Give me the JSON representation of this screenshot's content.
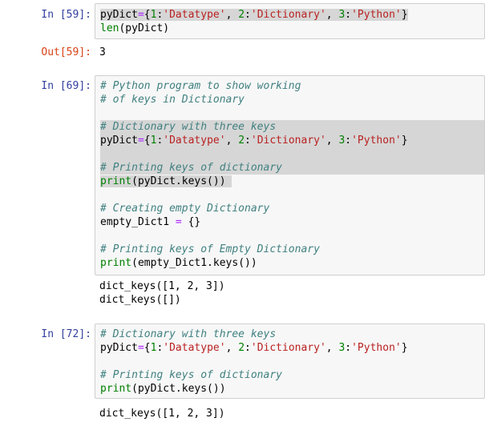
{
  "cells": [
    {
      "in_prompt": "In [59]:",
      "lines": [
        [
          "pyDict",
          "=",
          "{",
          "1",
          ":",
          "'Datatype'",
          ", ",
          "2",
          ":",
          "'Dictionary'",
          ", ",
          "3",
          ":",
          "'Python'",
          "}"
        ],
        [
          "len",
          "(pyDict)"
        ]
      ],
      "out_prompt": "Out[59]:",
      "output": "3"
    },
    {
      "in_prompt": "In [69]:",
      "lines": {
        "c1": "# Python program to show working",
        "c2": "# of keys in Dictionary",
        "c3": "# Dictionary with three keys",
        "c4": "# Printing keys of dictionary",
        "c5": "# Creating empty Dictionary",
        "c6": "# Printing keys of Empty Dictionary"
      },
      "output_lines": [
        "dict_keys([1, 2, 3])",
        "dict_keys([])"
      ]
    },
    {
      "in_prompt": "In [72]:",
      "lines": {
        "c1": "# Dictionary with three keys",
        "c2": "# Printing keys of dictionary"
      },
      "output_lines": [
        "dict_keys([1, 2, 3])"
      ]
    }
  ],
  "tokens": {
    "pyDict": "pyDict",
    "eq": "=",
    "lbrace": "{",
    "rbrace": "}",
    "one": "1",
    "two": "2",
    "three": "3",
    "colon": ":",
    "comma": ", ",
    "s_datatype": "'Datatype'",
    "s_dictionary": "'Dictionary'",
    "s_python": "'Python'",
    "len": "len",
    "len_arg": "(pyDict)",
    "print": "print",
    "print_keys_arg": "(pyDict.keys())",
    "empty_dict_name": "empty_Dict1 ",
    "empty_dict_value": " {}",
    "print_empty_arg": "(empty_Dict1.keys())"
  }
}
